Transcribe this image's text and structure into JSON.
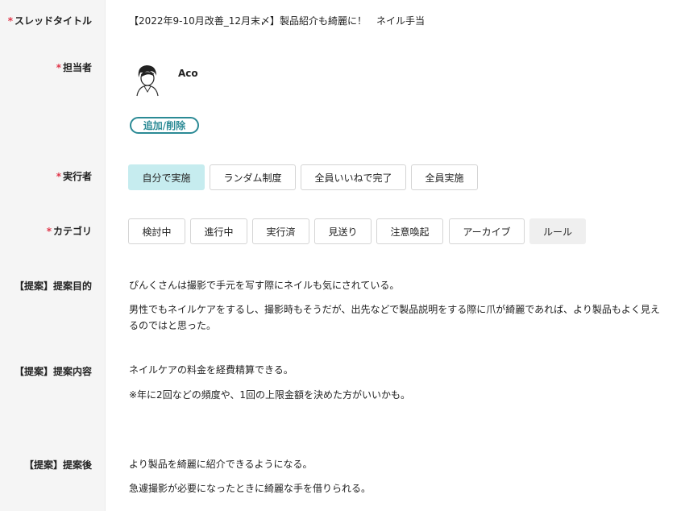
{
  "labels": {
    "thread_title": "スレッドタイトル",
    "assignee": "担当者",
    "executor": "実行者",
    "category": "カテゴリ",
    "purpose": "【提案】提案目的",
    "content": "【提案】提案内容",
    "after": "【提案】提案後"
  },
  "required_mark": "*",
  "thread_title_value": "【2022年9-10月改善_12月末〆】製品紹介も綺麗に！　ネイル手当",
  "assignee": {
    "name": "Aco",
    "add_remove_label": "追加/削除"
  },
  "executor_options": [
    {
      "label": "自分で実施",
      "selected": true
    },
    {
      "label": "ランダム制度",
      "selected": false
    },
    {
      "label": "全員いいねで完了",
      "selected": false
    },
    {
      "label": "全員実施",
      "selected": false
    }
  ],
  "category_options": [
    {
      "label": "検討中"
    },
    {
      "label": "進行中"
    },
    {
      "label": "実行済"
    },
    {
      "label": "見送り"
    },
    {
      "label": "注意喚起"
    },
    {
      "label": "アーカイブ"
    },
    {
      "label": "ルール",
      "style": "gray"
    }
  ],
  "purpose": {
    "p1": "ぴんくさんは撮影で手元を写す際にネイルも気にされている。",
    "p2": "男性でもネイルケアをするし、撮影時もそうだが、出先などで製品説明をする際に爪が綺麗であれば、より製品もよく見えるのではと思った。"
  },
  "content": {
    "p1": "ネイルケアの料金を経費精算できる。",
    "p2": "※年に2回などの頻度や、1回の上限金額を決めた方がいいかも。"
  },
  "after": {
    "p1": "より製品を綺麗に紹介できるようになる。",
    "p2": "急遽撮影が必要になったときに綺麗な手を借りられる。"
  },
  "colors": {
    "required": "#e0364a",
    "accent": "#2b8a95",
    "selected_chip": "#c6ecef"
  }
}
